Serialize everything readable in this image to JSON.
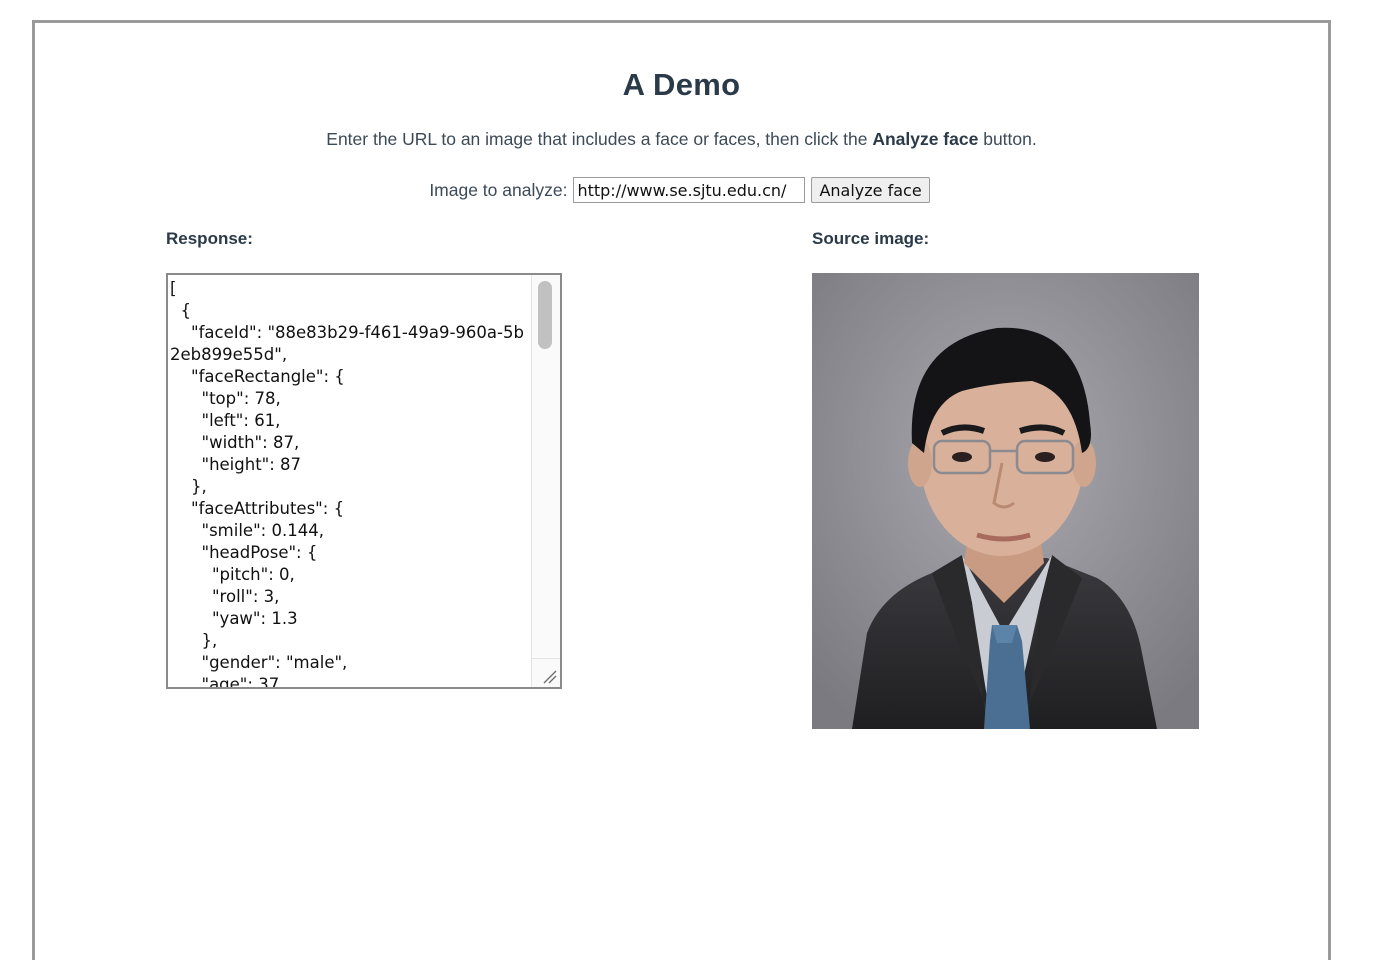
{
  "page": {
    "title": "A Demo",
    "instructions_before": "Enter the URL to an image that includes a face or faces, then click the ",
    "instructions_bold": "Analyze face",
    "instructions_after": " button."
  },
  "form": {
    "label": "Image to analyze:",
    "url_value": "http://www.se.sjtu.edu.cn/",
    "button_label": "Analyze face"
  },
  "response": {
    "label": "Response:",
    "text": "[\n  {\n    \"faceId\": \"88e83b29-f461-49a9-960a-5b2eb899e55d\",\n    \"faceRectangle\": {\n      \"top\": 78,\n      \"left\": 61,\n      \"width\": 87,\n      \"height\": 87\n    },\n    \"faceAttributes\": {\n      \"smile\": 0.144,\n      \"headPose\": {\n        \"pitch\": 0,\n        \"roll\": 3,\n        \"yaw\": 1.3\n      },\n      \"gender\": \"male\",\n      \"age\": 37"
  },
  "source": {
    "label": "Source image:"
  },
  "colors": {
    "heading": "#2b3a48",
    "body_text": "#3c4a57",
    "frame_border": "#9a9a9a",
    "photo_background": "#9a9aa0",
    "suit": "#2e2e31",
    "shirt": "#c9cdd3",
    "tie": "#4a6f92",
    "skin": "#d9b19a",
    "hair": "#141416"
  }
}
